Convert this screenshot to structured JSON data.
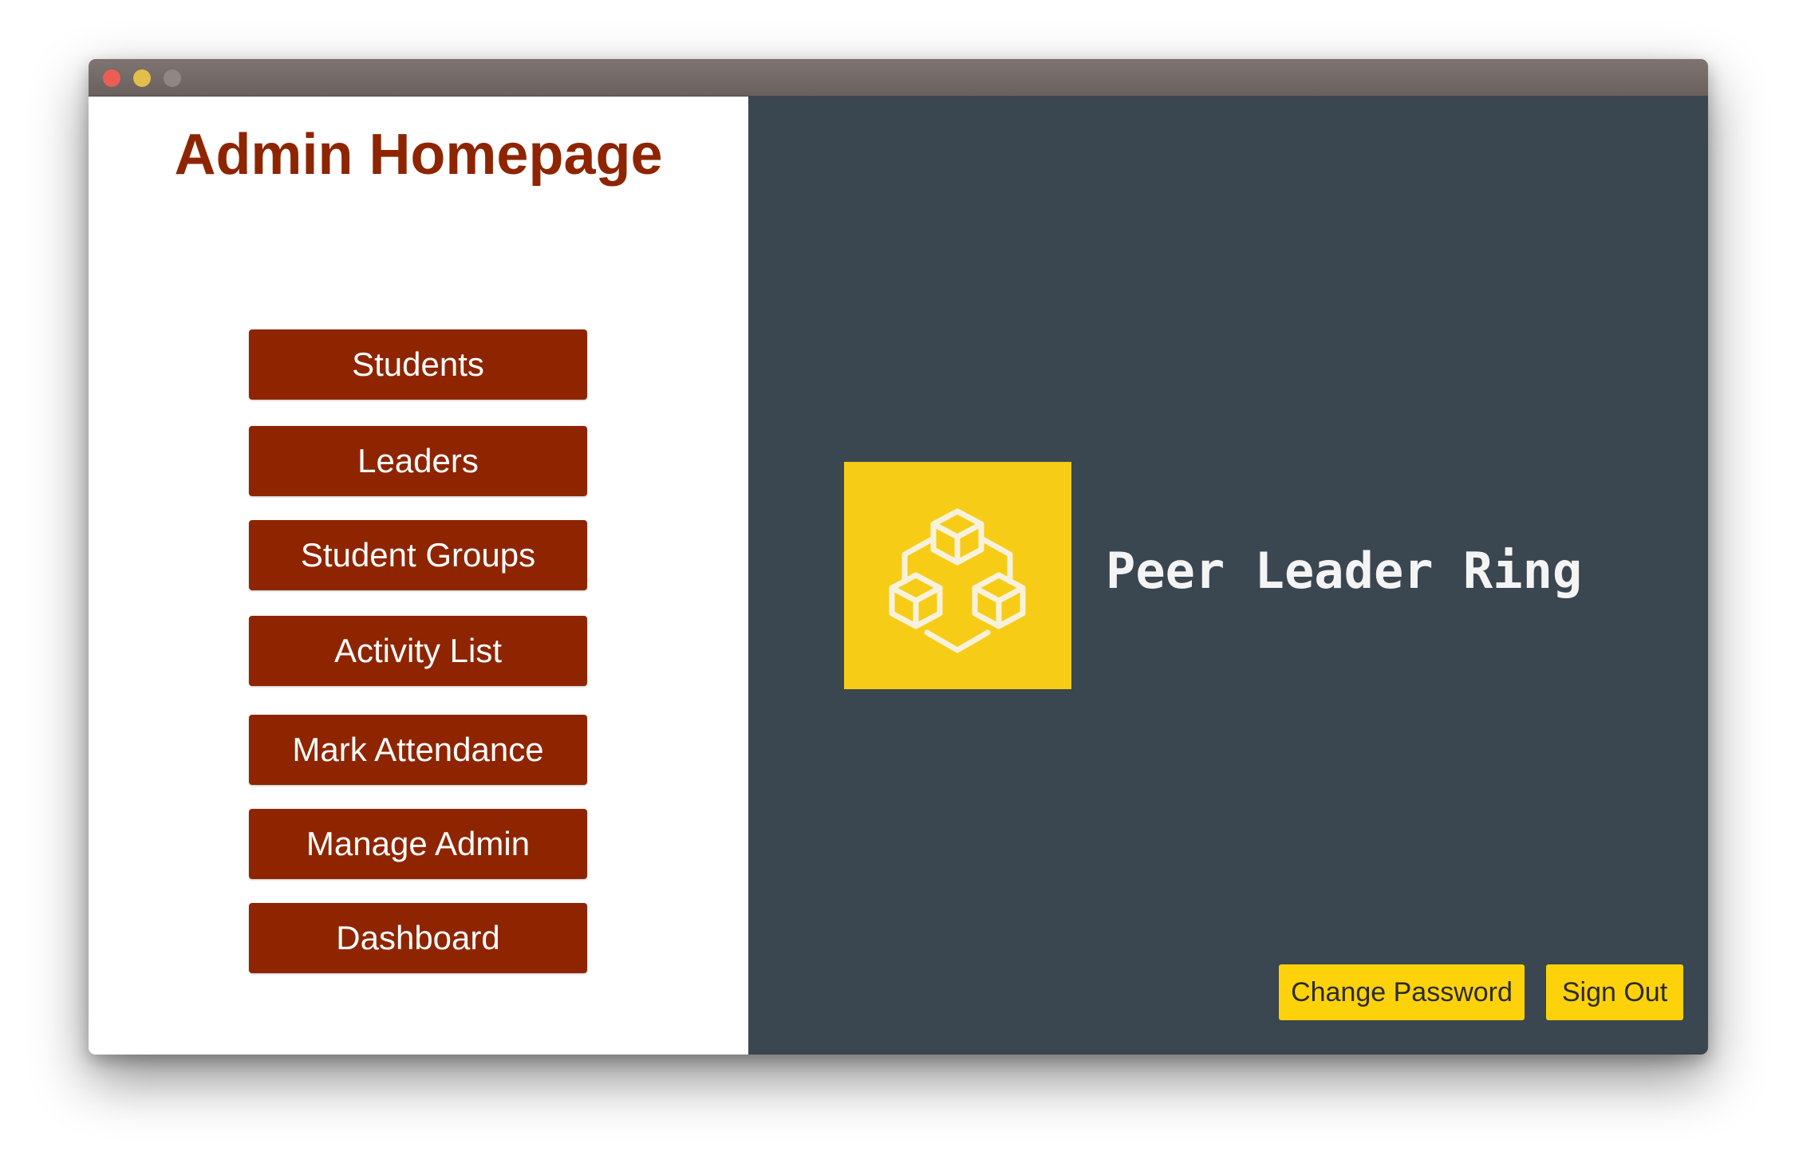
{
  "window": {
    "controls": [
      "close",
      "minimize",
      "maximize"
    ]
  },
  "sidebar": {
    "title": "Admin Homepage",
    "items": [
      {
        "label": "Students"
      },
      {
        "label": "Leaders"
      },
      {
        "label": "Student Groups"
      },
      {
        "label": "Activity List"
      },
      {
        "label": "Mark Attendance"
      },
      {
        "label": "Manage Admin"
      },
      {
        "label": "Dashboard"
      }
    ]
  },
  "brand": {
    "logo_icon": "cubes-network-icon",
    "name": "Peer Leader Ring"
  },
  "actions": {
    "change_password": "Change Password",
    "sign_out": "Sign Out"
  },
  "colors": {
    "accent": "#8e2500",
    "panel": "#3a4650",
    "highlight": "#fdd20b"
  }
}
